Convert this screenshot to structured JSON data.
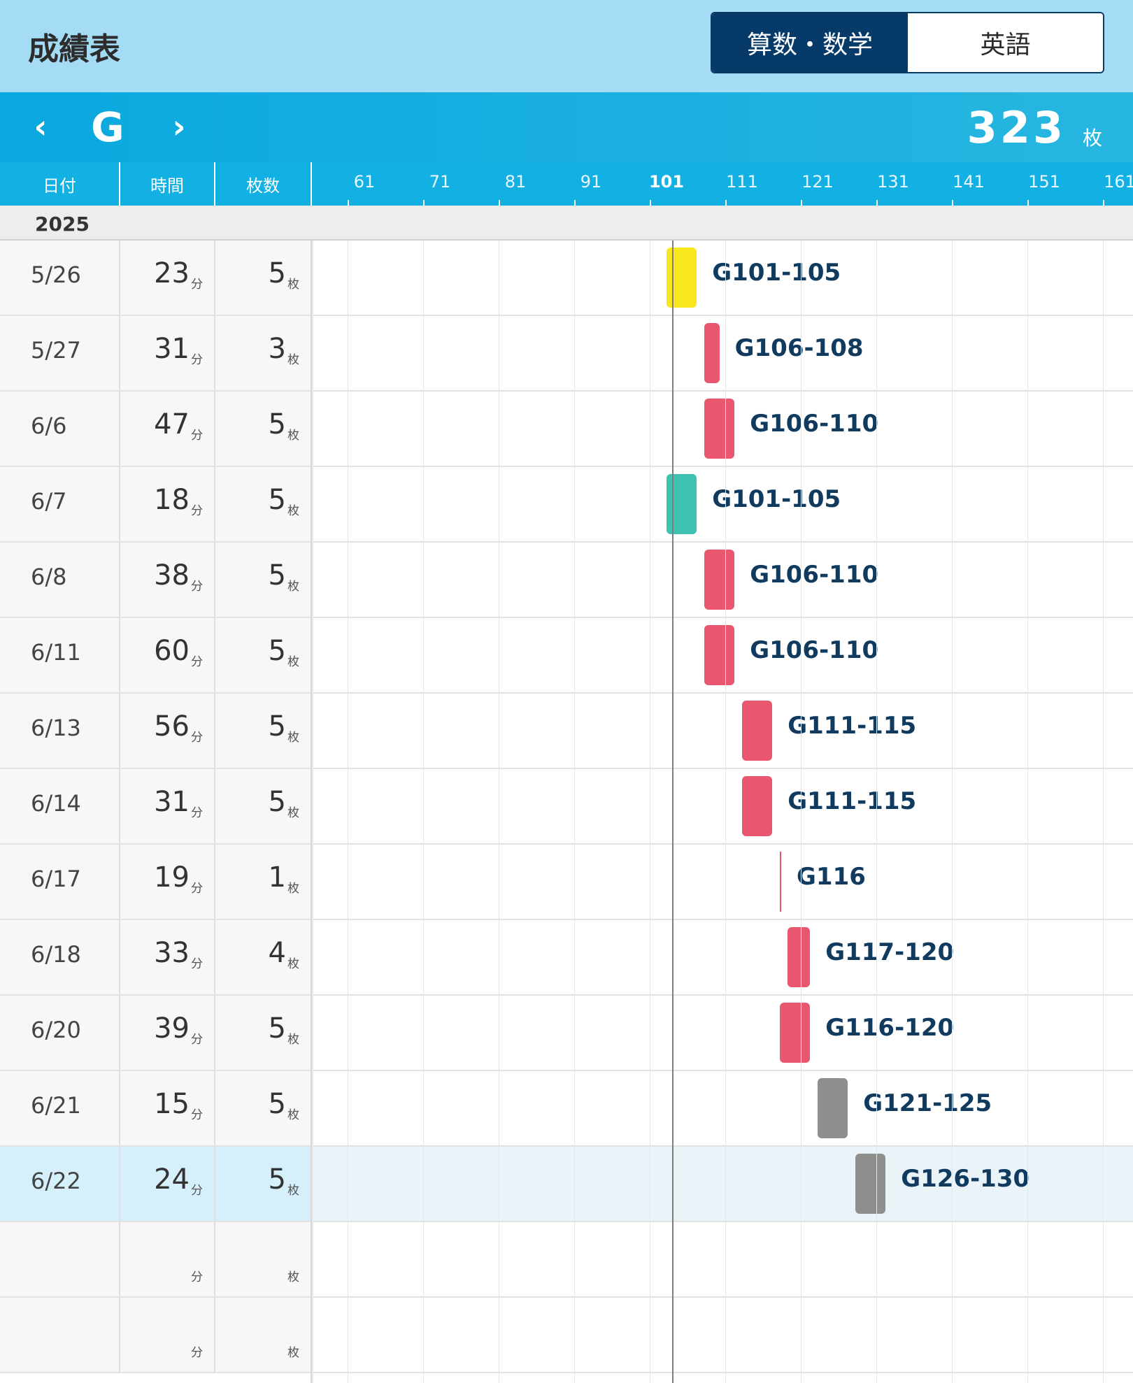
{
  "header": {
    "title": "成績表"
  },
  "subjects": {
    "math": "算数・数学",
    "english": "英語"
  },
  "nav": {
    "prev": "‹",
    "next": "›",
    "level": "G",
    "total": "323",
    "total_unit": "枚"
  },
  "columns": {
    "date": "日付",
    "time": "時間",
    "sheets": "枚数"
  },
  "ticks": [
    "61",
    "71",
    "81",
    "91",
    "101",
    "111",
    "121",
    "131",
    "141",
    "151",
    "161"
  ],
  "year": "2025",
  "units": {
    "min": "分",
    "sheet": "枚"
  },
  "rows": [
    {
      "date": "5/26",
      "min": "23",
      "sheets": "5",
      "label": "G101-105",
      "start": 101,
      "end": 105,
      "color": "#f8e71c"
    },
    {
      "date": "5/27",
      "min": "31",
      "sheets": "3",
      "label": "G106-108",
      "start": 106,
      "end": 108,
      "color": "#e8566f"
    },
    {
      "date": "6/6",
      "min": "47",
      "sheets": "5",
      "label": "G106-110",
      "start": 106,
      "end": 110,
      "color": "#e8566f"
    },
    {
      "date": "6/7",
      "min": "18",
      "sheets": "5",
      "label": "G101-105",
      "start": 101,
      "end": 105,
      "color": "#3ec1b0"
    },
    {
      "date": "6/8",
      "min": "38",
      "sheets": "5",
      "label": "G106-110",
      "start": 106,
      "end": 110,
      "color": "#e8566f"
    },
    {
      "date": "6/11",
      "min": "60",
      "sheets": "5",
      "label": "G106-110",
      "start": 106,
      "end": 110,
      "color": "#e8566f"
    },
    {
      "date": "6/13",
      "min": "56",
      "sheets": "5",
      "label": "G111-115",
      "start": 111,
      "end": 115,
      "color": "#e8566f"
    },
    {
      "date": "6/14",
      "min": "31",
      "sheets": "5",
      "label": "G111-115",
      "start": 111,
      "end": 115,
      "color": "#e8566f"
    },
    {
      "date": "6/17",
      "min": "19",
      "sheets": "1",
      "label": "G116",
      "start": 116,
      "end": 116,
      "color": "#e8566f"
    },
    {
      "date": "6/18",
      "min": "33",
      "sheets": "4",
      "label": "G117-120",
      "start": 117,
      "end": 120,
      "color": "#e8566f"
    },
    {
      "date": "6/20",
      "min": "39",
      "sheets": "5",
      "label": "G116-120",
      "start": 116,
      "end": 120,
      "color": "#e8566f"
    },
    {
      "date": "6/21",
      "min": "15",
      "sheets": "5",
      "label": "G121-125",
      "start": 121,
      "end": 125,
      "color": "#8e8e8e"
    },
    {
      "date": "6/22",
      "min": "24",
      "sheets": "5",
      "label": "G126-130",
      "start": 126,
      "end": 130,
      "color": "#8e8e8e",
      "selected": true
    },
    {
      "date": "",
      "min": "",
      "sheets": "",
      "label": "",
      "start": null,
      "end": null
    },
    {
      "date": "",
      "min": "",
      "sheets": "",
      "label": "",
      "start": null,
      "end": null
    }
  ]
}
